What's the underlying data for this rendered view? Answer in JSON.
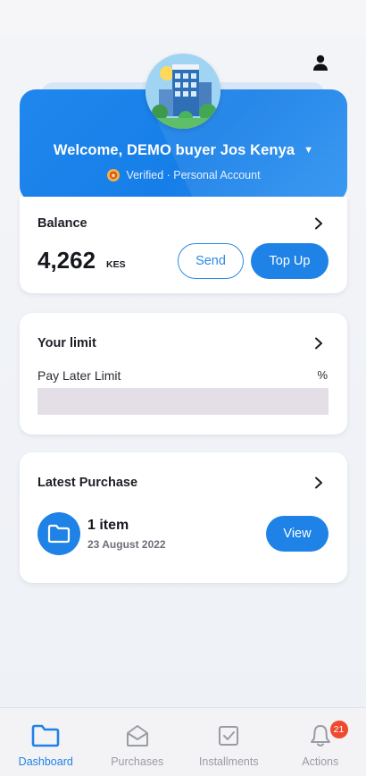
{
  "header": {
    "welcome": "Welcome, DEMO buyer Jos Kenya",
    "verified": "Verified · Personal Account",
    "avatar_icon": "building-avatar-icon",
    "profile_icon": "user-icon"
  },
  "balance": {
    "title": "Balance",
    "amount": "4,262",
    "currency": "KES",
    "send_label": "Send",
    "topup_label": "Top Up"
  },
  "limit": {
    "title": "Your limit",
    "label": "Pay Later Limit",
    "percent_text": "%",
    "progress": 0
  },
  "purchase": {
    "title": "Latest Purchase",
    "item_count": "1 item",
    "date": "23 August 2022",
    "view_label": "View"
  },
  "nav": {
    "items": [
      {
        "label": "Dashboard",
        "icon": "folder-icon",
        "active": true
      },
      {
        "label": "Purchases",
        "icon": "inbox-icon",
        "active": false
      },
      {
        "label": "Installments",
        "icon": "checkbox-icon",
        "active": false
      },
      {
        "label": "Actions",
        "icon": "bell-icon",
        "active": false,
        "badge": "21"
      }
    ]
  },
  "colors": {
    "accent": "#1e82e6",
    "badge": "#ef4a2f"
  }
}
